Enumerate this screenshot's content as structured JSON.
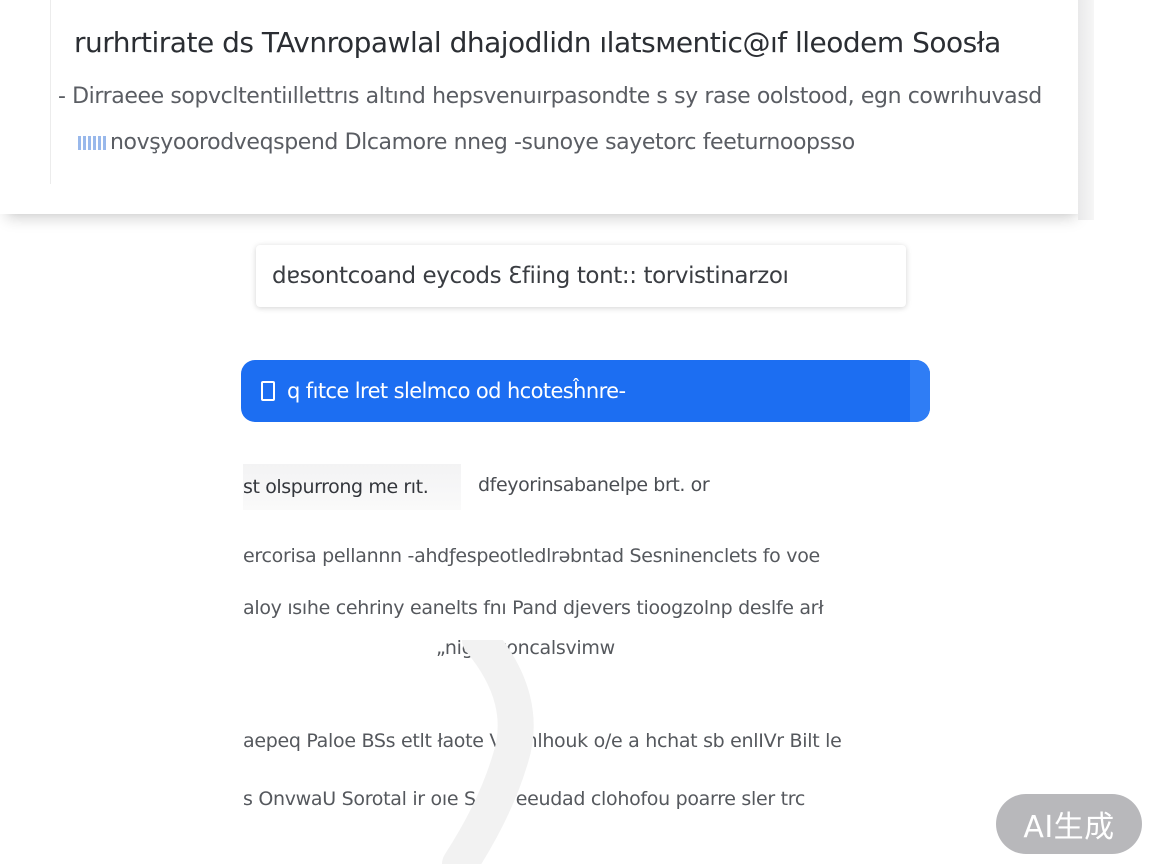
{
  "header": {
    "title": "rurhrtirate ds TAvnropawlal dhajodlidn ılatsмentic@ıf lleodem Soosła",
    "subtitle": "- Dirraeee sopvcltentiıllettrıs altınd hepsvenuırpasondte s sy rase oolstood, egn cowrıhuvasd",
    "description": "novşyoorodveqspend Dlcamore nneg -sunoye sayetorc  feeturnoopsso"
  },
  "query_box": {
    "text": "dɐsontcoand eycods Ɛfiing tont:: torvistinarzoı"
  },
  "primary_button": {
    "label": "q  fıtce lret slelmco od hcotesĥnre-"
  },
  "options": {
    "tab_label": "st olspurrong me rıt.",
    "link_label": "dfeyorinsabanelpe brt.  or"
  },
  "body": {
    "line1": "ercorisa pellannn -ahdƒespeotledlrəbntad Sesninenclets fo voe",
    "line2": "aloy ısıhe cehriny eanelts fnı Pand djevers tioogzolnp deslfe arł",
    "line3": "„nigjo voncalsvimw",
    "line4": "aepeq Paloe BSs etlt łaote Vatmlhouk o/e a hchat sb enlIVr Bilt le",
    "line5": "s OnvwaU Sorotal ir oıe Seecreeudad clohofou poarre sler  trc"
  },
  "badge": {
    "label": "AI生成"
  },
  "colors": {
    "primary": "#1c6ef2",
    "badge_bg": "#a0a0a4",
    "text": "#3a3d42"
  }
}
